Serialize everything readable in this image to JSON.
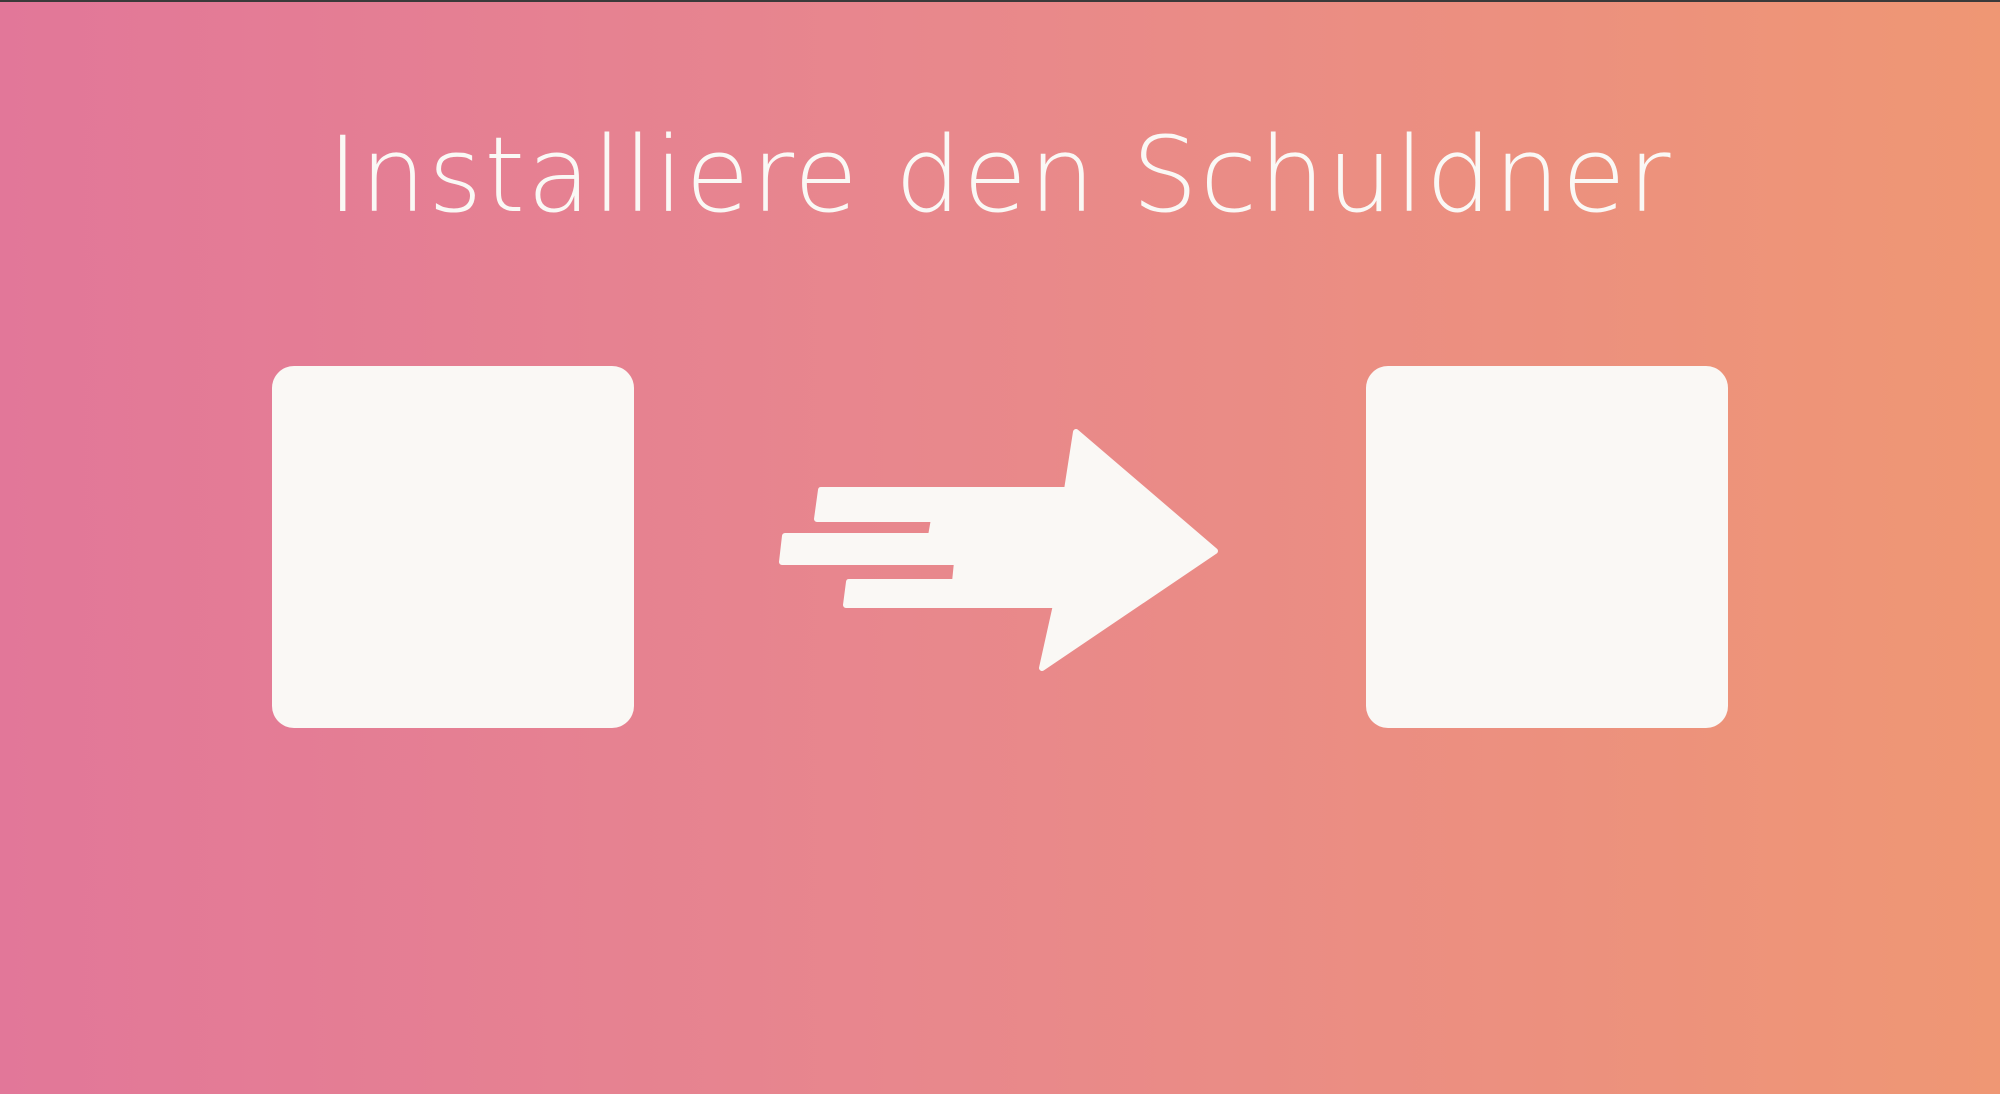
{
  "slide": {
    "title": "Installiere den Schuldner"
  },
  "colors": {
    "gradient_start": "#e27799",
    "gradient_end": "#ef9774",
    "foreground": "#faf8f5"
  },
  "icons": {
    "transfer": "fast-arrow-right-icon"
  }
}
